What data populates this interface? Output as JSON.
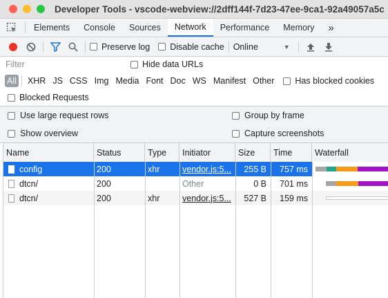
{
  "window": {
    "title": "Developer Tools - vscode-webview://2dff144f-7d23-47ee-9ca1-92a49057a5c",
    "traffic_lights": {
      "close": "#ff5f57",
      "minimize": "#febc2e",
      "zoom": "#28c840"
    }
  },
  "tabs": {
    "items": [
      "Elements",
      "Console",
      "Sources",
      "Network",
      "Performance",
      "Memory"
    ],
    "active": "Network",
    "more": "»"
  },
  "toolbar": {
    "record_color": "#ea3323",
    "preserve_log": "Preserve log",
    "disable_cache": "Disable cache",
    "throttling": "Online",
    "throttling_arrow": "▼"
  },
  "filter": {
    "placeholder": "Filter",
    "hide_data_urls": "Hide data URLs"
  },
  "types": {
    "items": [
      "All",
      "XHR",
      "JS",
      "CSS",
      "Img",
      "Media",
      "Font",
      "Doc",
      "WS",
      "Manifest",
      "Other"
    ],
    "active": "All",
    "has_blocked_cookies": "Has blocked cookies",
    "blocked_requests": "Blocked Requests"
  },
  "settings": {
    "large_rows": "Use large request rows",
    "group_by_frame": "Group by frame",
    "show_overview": "Show overview",
    "capture_screenshots": "Capture screenshots"
  },
  "table": {
    "columns": [
      "Name",
      "Status",
      "Type",
      "Initiator",
      "Size",
      "Time",
      "Waterfall"
    ],
    "rows": [
      {
        "name": "config",
        "status": "200",
        "type": "xhr",
        "initiator": "vendor.js:5...",
        "initiator_link": true,
        "size": "255 B",
        "time": "757 ms",
        "selected": true
      },
      {
        "name": "dtcn/",
        "status": "200",
        "type": "",
        "initiator": "Other",
        "initiator_link": false,
        "size": "0 B",
        "time": "701 ms",
        "selected": false
      },
      {
        "name": "dtcn/",
        "status": "200",
        "type": "xhr",
        "initiator": "vendor.js:5...",
        "initiator_link": true,
        "size": "527 B",
        "time": "159 ms",
        "selected": false
      }
    ]
  },
  "colors": {
    "accent": "#1a73e8",
    "waterfall_stalled": "#a6a6a6",
    "waterfall_connect": "#21a68e",
    "waterfall_waiting": "#f59a1b",
    "waterfall_download": "#a314c7"
  }
}
